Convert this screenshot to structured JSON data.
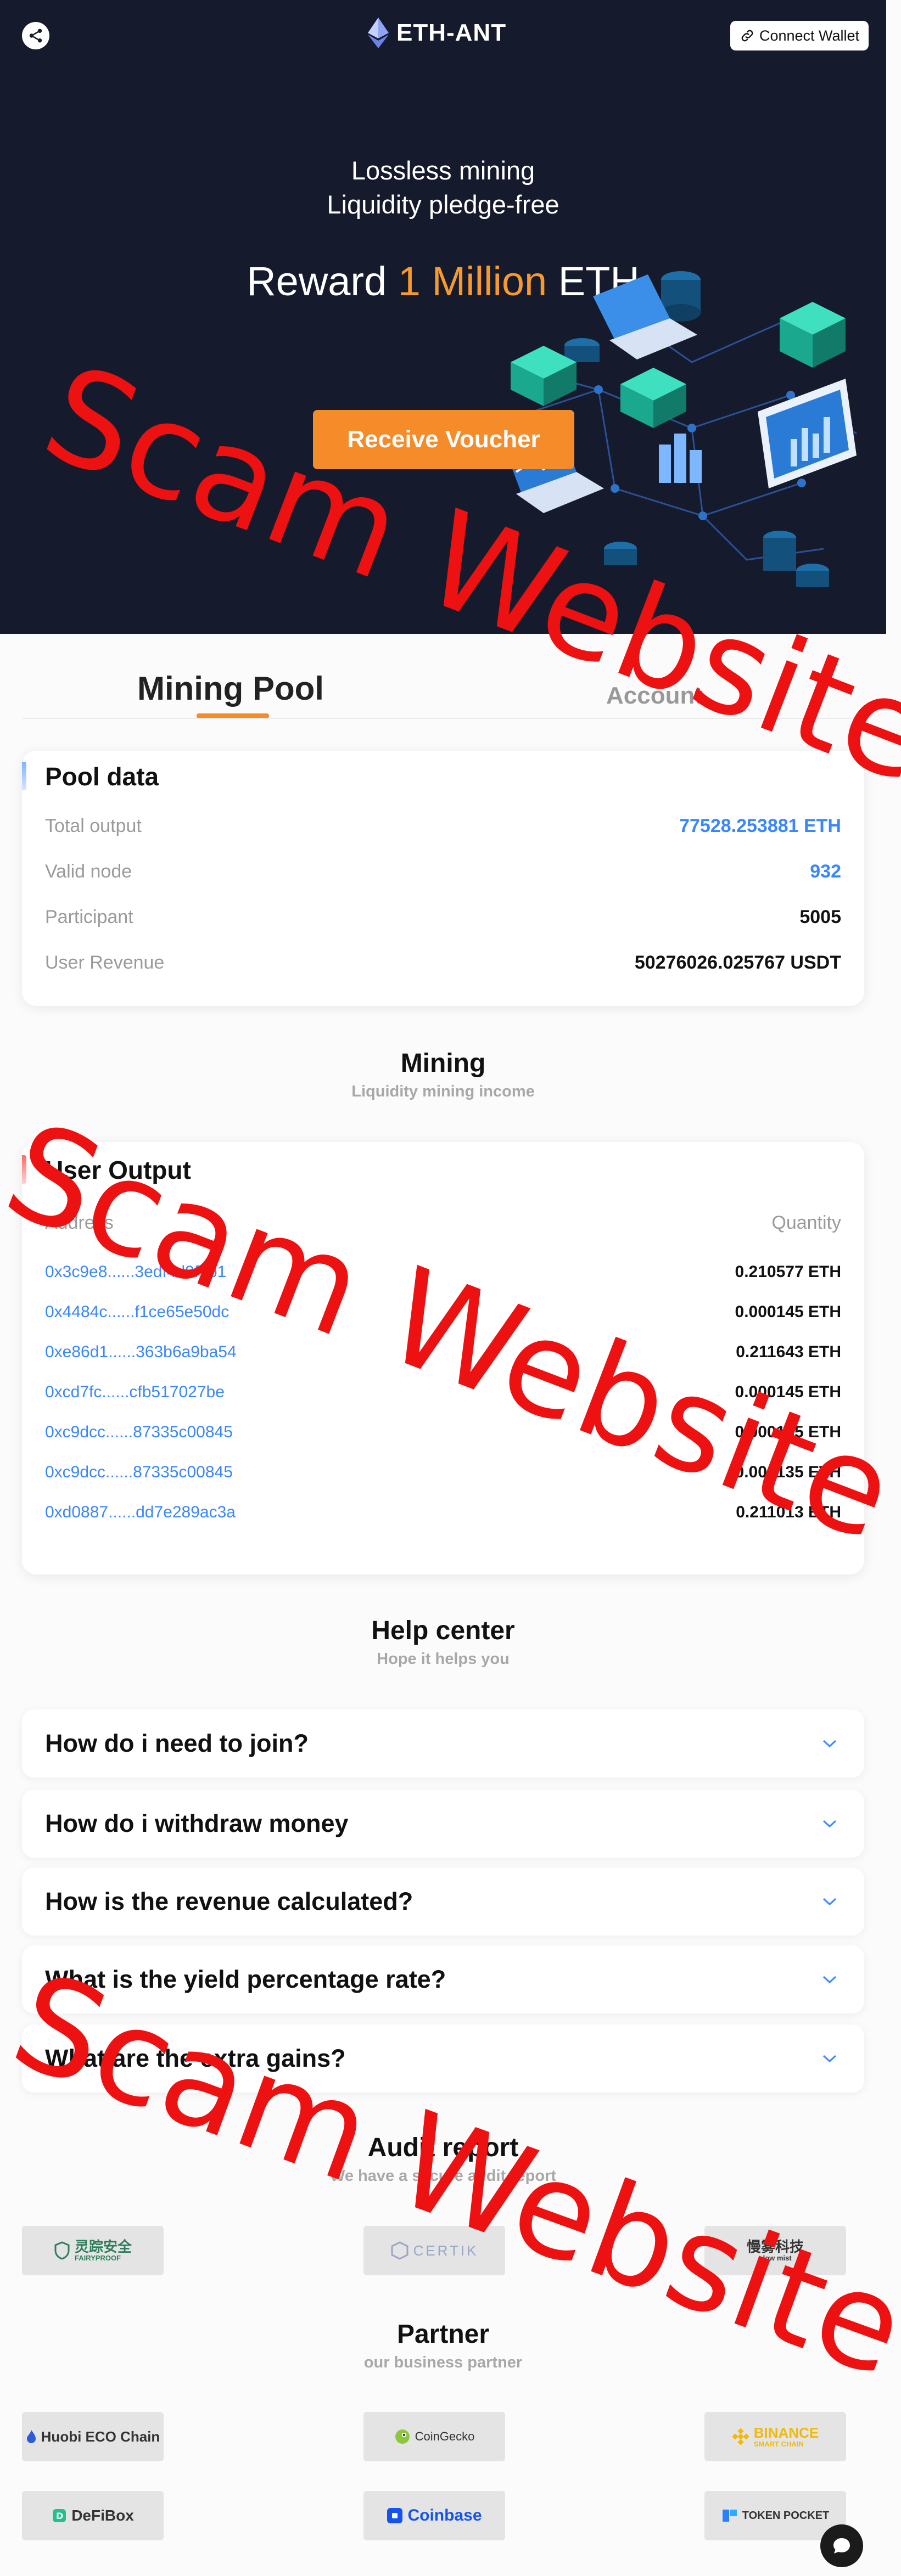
{
  "header": {
    "brand": "ETH-ANT",
    "connect_label": "Connect Wallet"
  },
  "hero": {
    "line1": "Lossless mining",
    "line2": "Liquidity pledge-free",
    "reward_prefix": "Reward",
    "reward_highlight": "1 Million",
    "reward_suffix": "ETH",
    "voucher_label": "Receive Voucher"
  },
  "tabs": [
    {
      "label": "Mining Pool",
      "active": true
    },
    {
      "label": "Account",
      "active": false
    }
  ],
  "pool": {
    "title": "Pool data",
    "rows": [
      {
        "label": "Total output",
        "value": "77528.253881 ETH"
      },
      {
        "label": "Valid node",
        "value": "932"
      },
      {
        "label": "Participant",
        "value": "5005"
      },
      {
        "label": "User Revenue",
        "value": "50276026.025767 USDT"
      }
    ]
  },
  "mining": {
    "title": "Mining",
    "subtitle": "Liquidity mining income"
  },
  "output": {
    "title": "User Output",
    "col_address": "Address",
    "col_quantity": "Quantity",
    "rows": [
      {
        "address": "0x3c9e8......3edf4d9f7b1",
        "quantity": "0.210577 ETH"
      },
      {
        "address": "0x4484c......f1ce65e50dc",
        "quantity": "0.000145 ETH"
      },
      {
        "address": "0xe86d1......363b6a9ba54",
        "quantity": "0.211643 ETH"
      },
      {
        "address": "0xcd7fc......cfb517027be",
        "quantity": "0.000145 ETH"
      },
      {
        "address": "0xc9dcc......87335c00845",
        "quantity": "0.000135 ETH"
      },
      {
        "address": "0xc9dcc......87335c00845",
        "quantity": "0.000135 ETH"
      },
      {
        "address": "0xd0887......dd7e289ac3a",
        "quantity": "0.211013 ETH"
      }
    ]
  },
  "help": {
    "title": "Help center",
    "subtitle": "Hope it helps you",
    "items": [
      "How do i need to join?",
      "How do i withdraw money",
      "How is the revenue calculated?",
      "What is the yield percentage rate?",
      "What are the extra gains?"
    ]
  },
  "audit": {
    "title": "Audit report",
    "subtitle": "We have a secure audit report",
    "logos": [
      "灵踪安全",
      "CERTIK",
      "慢雾科技"
    ],
    "logo_sub": [
      "FAIRYPROOF",
      "",
      "slow mist"
    ]
  },
  "partner": {
    "title": "Partner",
    "subtitle": "our business partner",
    "logos": [
      "Huobi ECO Chain",
      "CoinGecko",
      "BINANCE",
      "DeFiBox",
      "Coinbase",
      "TOKEN POCKET"
    ],
    "logo_sub": [
      "",
      "",
      "SMART CHAIN",
      "",
      "",
      ""
    ]
  },
  "watermark": "Scam Website",
  "colors": {
    "hero_bg": "#161a2d",
    "accent_orange": "#f68b2a",
    "link_blue": "#3a86ff",
    "watermark_red": "#ee1111"
  }
}
